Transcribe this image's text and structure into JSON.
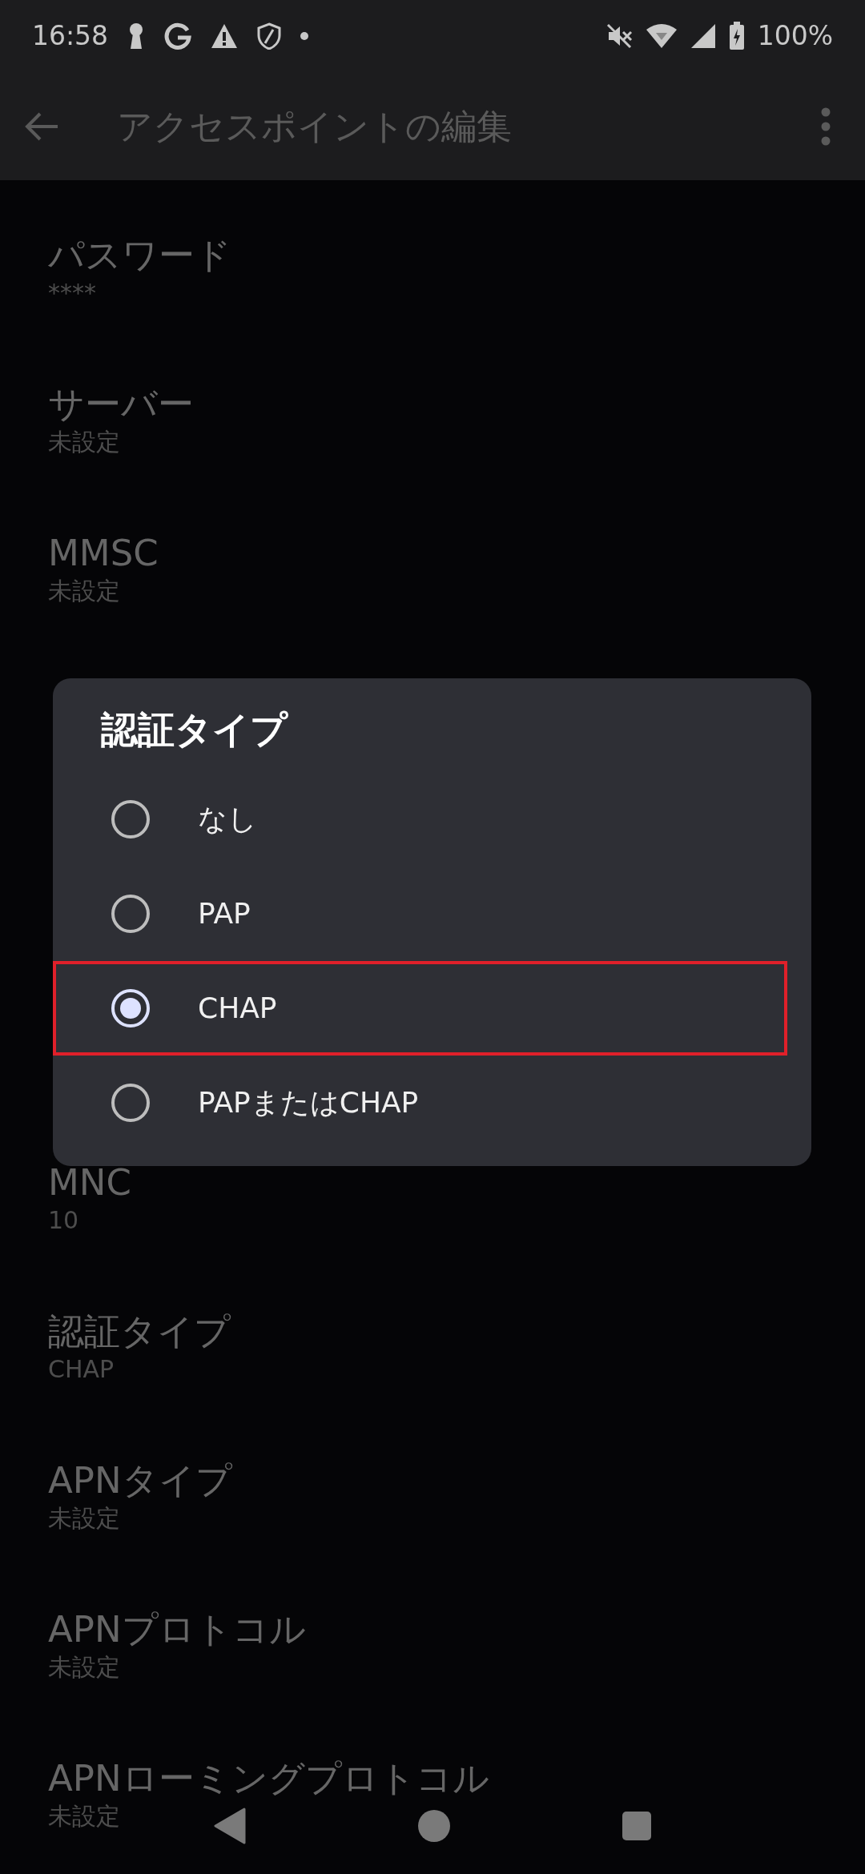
{
  "status_bar": {
    "time": "16:58",
    "battery": "100%"
  },
  "app_bar": {
    "title": "アクセスポイントの編集"
  },
  "settings": [
    {
      "title": "パスワード",
      "value": "****"
    },
    {
      "title": "サーバー",
      "value": "未設定"
    },
    {
      "title": "MMSC",
      "value": "未設定"
    },
    {
      "title": "MNC",
      "value": "10"
    },
    {
      "title": "認証タイプ",
      "value": "CHAP"
    },
    {
      "title": "APNタイプ",
      "value": "未設定"
    },
    {
      "title": "APNプロトコル",
      "value": "未設定"
    },
    {
      "title": "APNローミングプロトコル",
      "value": "未設定"
    }
  ],
  "dialog": {
    "title": "認証タイプ",
    "options": [
      {
        "label": "なし",
        "selected": false,
        "highlighted": false
      },
      {
        "label": "PAP",
        "selected": false,
        "highlighted": false
      },
      {
        "label": "CHAP",
        "selected": true,
        "highlighted": true
      },
      {
        "label": "PAPまたはCHAP",
        "selected": false,
        "highlighted": false
      }
    ]
  }
}
